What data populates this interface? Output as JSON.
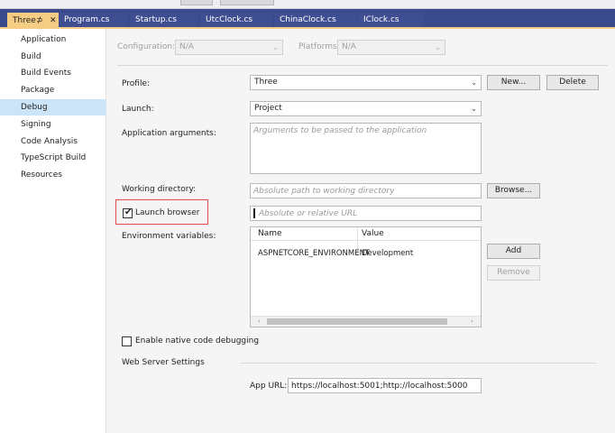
{
  "tabs": [
    {
      "label": "Three",
      "pin": "⊅",
      "close": "✕",
      "active": true
    },
    {
      "label": "Program.cs"
    },
    {
      "label": "Startup.cs"
    },
    {
      "label": "UtcClock.cs"
    },
    {
      "label": "ChinaClock.cs"
    },
    {
      "label": "IClock.cs"
    }
  ],
  "sidebar": {
    "items": [
      {
        "label": "Application"
      },
      {
        "label": "Build"
      },
      {
        "label": "Build Events"
      },
      {
        "label": "Package"
      },
      {
        "label": "Debug",
        "selected": true
      },
      {
        "label": "Signing"
      },
      {
        "label": "Code Analysis"
      },
      {
        "label": "TypeScript Build"
      },
      {
        "label": "Resources"
      }
    ]
  },
  "config": {
    "configuration_label": "Configuration:",
    "configuration_value": "N/A",
    "platform_label": "Platforms:",
    "platform_value": "N/A"
  },
  "profile": {
    "label": "Profile:",
    "value": "Three",
    "new_button": "New...",
    "delete_button": "Delete"
  },
  "launch": {
    "label": "Launch:",
    "value": "Project"
  },
  "app_args": {
    "label": "Application arguments:",
    "placeholder": "Arguments to be passed to the application"
  },
  "working_dir": {
    "label": "Working directory:",
    "placeholder": "Absolute path to working directory",
    "browse_button": "Browse..."
  },
  "launch_browser": {
    "label": "Launch browser",
    "checked": true,
    "check_mark": "✔",
    "placeholder": "Absolute or relative URL"
  },
  "env": {
    "label": "Environment variables:",
    "col_name": "Name",
    "col_value": "Value",
    "rows": [
      {
        "name": "ASPNETCORE_ENVIRONMENT",
        "value": "Development"
      }
    ],
    "add_button": "Add",
    "remove_button": "Remove",
    "scroll_left": "‹",
    "scroll_right": "›"
  },
  "native_debug": {
    "label": "Enable native code debugging",
    "checked": false
  },
  "web_server": {
    "section_label": "Web Server Settings",
    "app_url_label": "App URL:",
    "app_url_value": "https://localhost:5001;http://localhost:5000"
  }
}
